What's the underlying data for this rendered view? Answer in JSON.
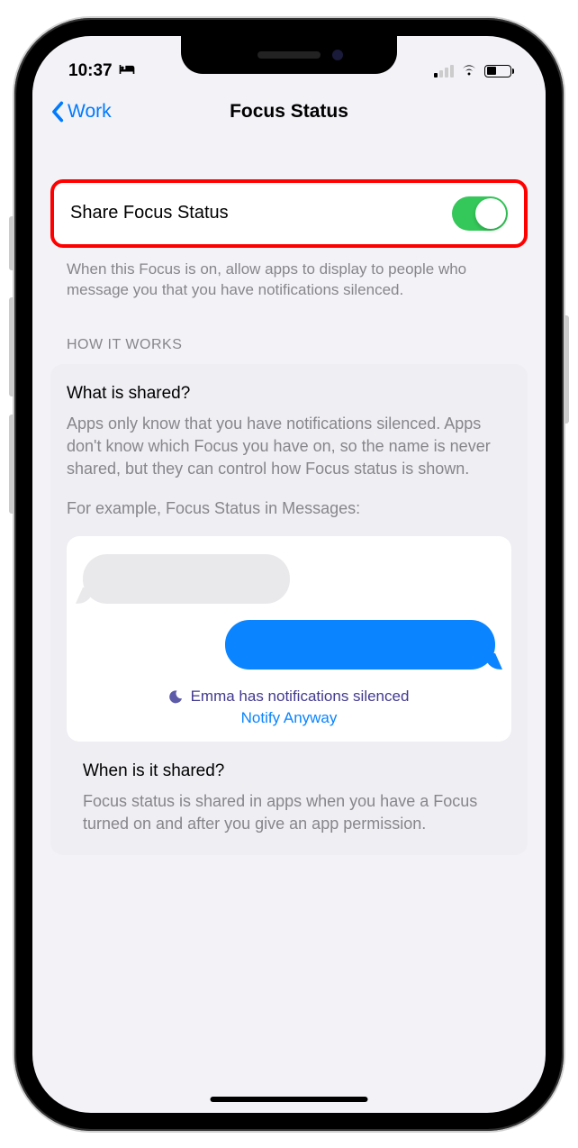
{
  "status_bar": {
    "time": "10:37",
    "dnd_icon": "bed-icon"
  },
  "nav": {
    "back_label": "Work",
    "title": "Focus Status"
  },
  "share_row": {
    "label": "Share Focus Status",
    "enabled": true
  },
  "share_description": "When this Focus is on, allow apps to display to people who message you that you have notifications silenced.",
  "how_it_works_header": "HOW IT WORKS",
  "info": {
    "what_title": "What is shared?",
    "what_text": "Apps only know that you have notifications silenced. Apps don't know which Focus you have on, so the name is never shared, but they can control how Focus status is shown.",
    "example_label": "For example, Focus Status in Messages:",
    "silenced_text": "Emma has notifications silenced",
    "notify_anyway": "Notify Anyway",
    "when_title": "When is it shared?",
    "when_text": "Focus status is shared in apps when you have a Focus turned on and after you give an app permission."
  }
}
